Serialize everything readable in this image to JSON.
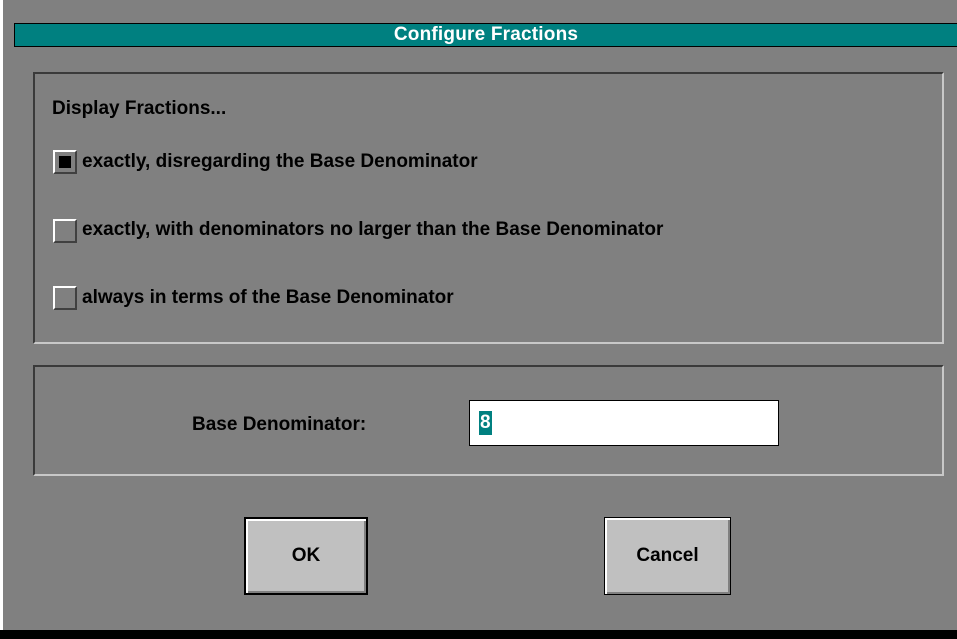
{
  "dialog": {
    "title": "Configure Fractions"
  },
  "display_group": {
    "heading": "Display Fractions...",
    "options": [
      {
        "label": "exactly, disregarding the Base Denominator",
        "checked": true
      },
      {
        "label": "exactly, with denominators no larger than the Base Denominator",
        "checked": false
      },
      {
        "label": "always in terms of the Base Denominator",
        "checked": false
      }
    ]
  },
  "base_group": {
    "label": "Base Denominator:",
    "value": "8"
  },
  "buttons": {
    "ok_label": "OK",
    "cancel_label": "Cancel"
  },
  "colors": {
    "window_bg": "#808080",
    "titlebar_bg": "#008080",
    "selection_bg": "#008080"
  }
}
